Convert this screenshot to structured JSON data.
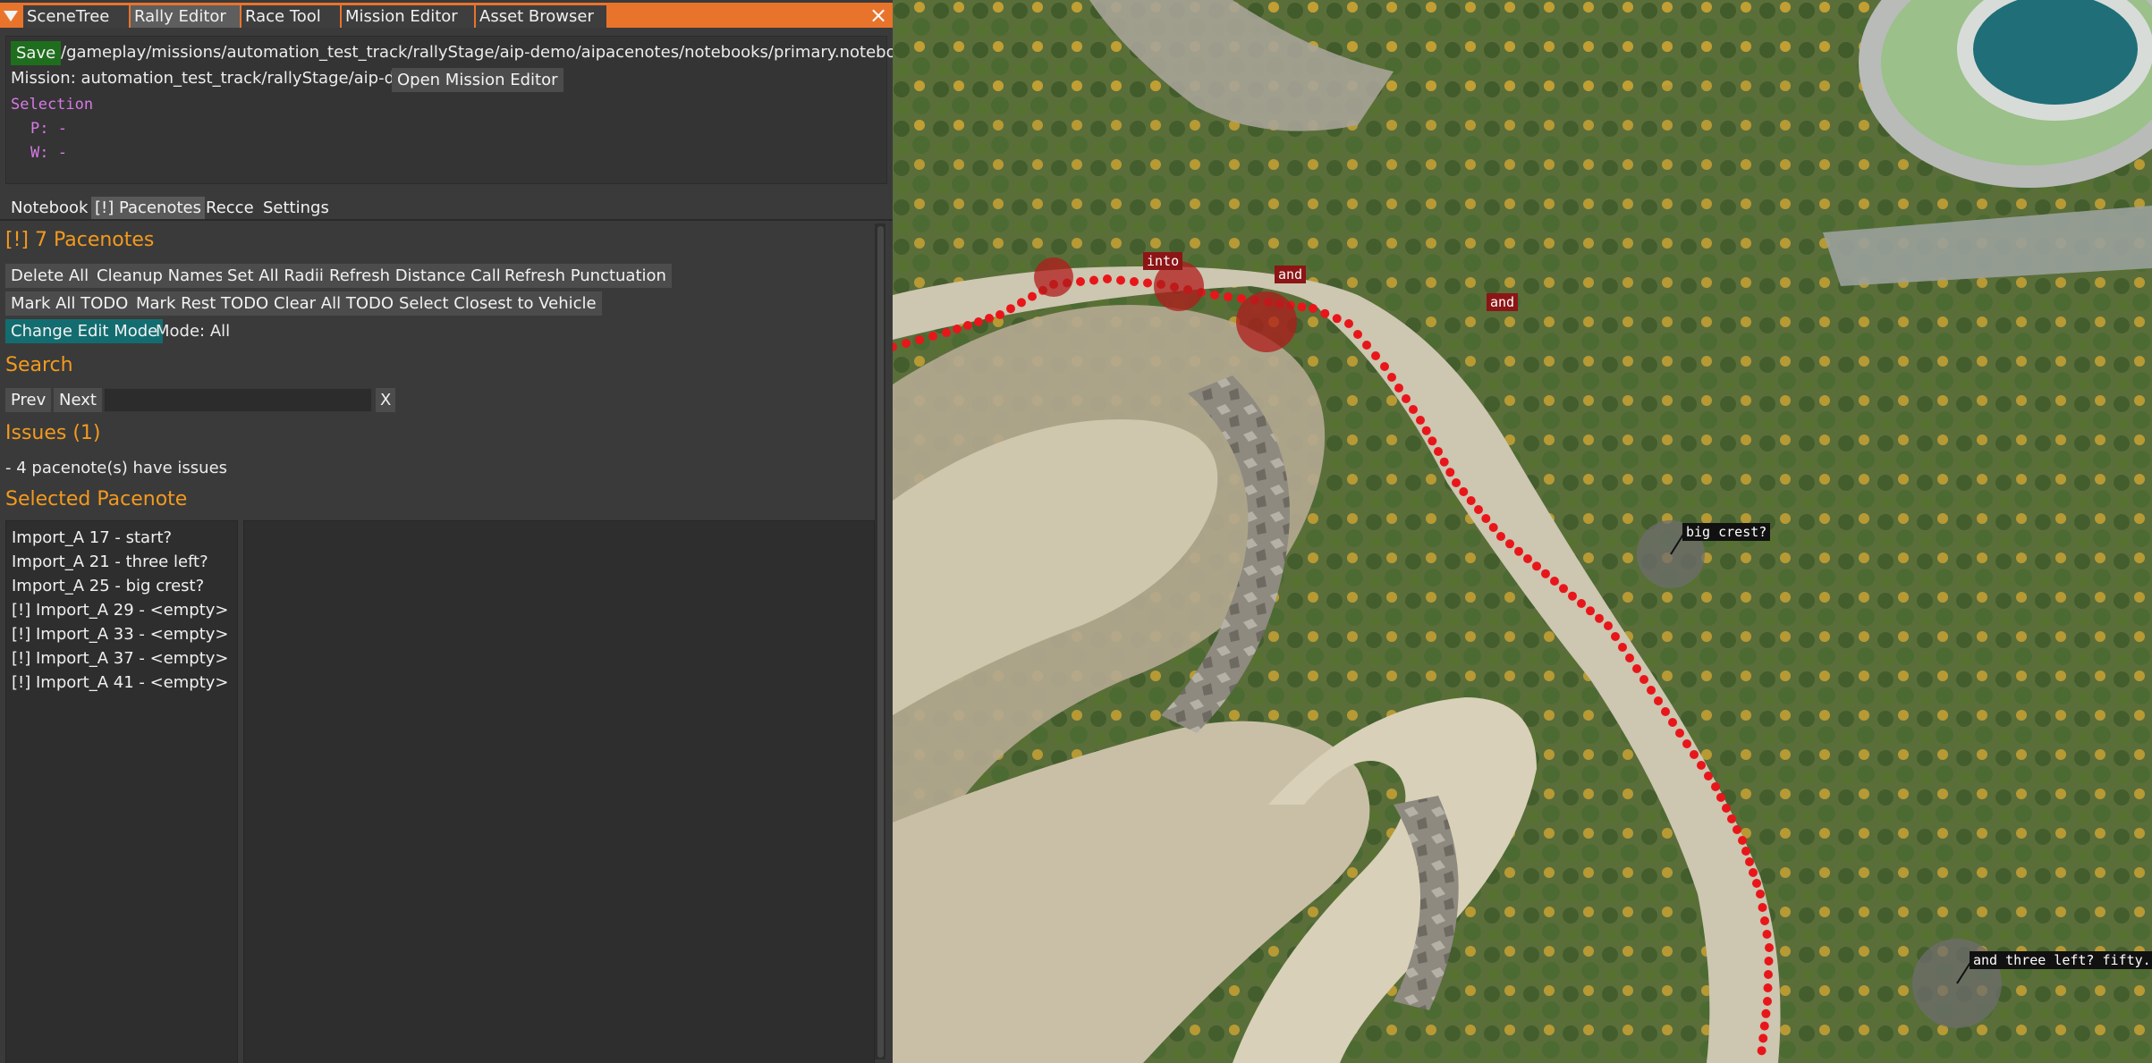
{
  "window_tabs": [
    "SceneTree",
    "Rally Editor",
    "Race Tool",
    "Mission Editor",
    "Asset Browser"
  ],
  "active_window_tab": "Rally Editor",
  "close_icon": "close-icon",
  "header": {
    "save_label": "Save",
    "notebook_path": "/gameplay/missions/automation_test_track/rallyStage/aip-demo/aipacenotes/notebooks/primary.notebook.json",
    "mission_text": "Mission: automation_test_track/rallyStage/aip-demo",
    "open_mission_editor_label": "Open Mission Editor",
    "selection_title": "Selection",
    "selection_p": "P: -",
    "selection_w": "W: -"
  },
  "sub_tabs": [
    "Notebook",
    "[!] Pacenotes",
    "Recce",
    "Settings"
  ],
  "active_sub_tab": "[!] Pacenotes",
  "pacenotes": {
    "title": "[!] 7 Pacenotes",
    "row1": [
      "Delete All",
      "Cleanup Names",
      "Set All Radii",
      "Refresh Distance Calls",
      "Refresh Punctuation"
    ],
    "row2": [
      "Mark All TODO",
      "Mark Rest TODO",
      "Clear All TODO",
      "Select Closest to Vehicle"
    ],
    "change_edit_mode_label": "Change Edit Mode",
    "mode_text": "Mode: All"
  },
  "search": {
    "title": "Search",
    "prev_label": "Prev",
    "next_label": "Next",
    "query": "",
    "clear_label": "X"
  },
  "issues": {
    "title": "Issues (1)",
    "line": "- 4 pacenote(s) have issues"
  },
  "selected_pacenote": {
    "title": "Selected Pacenote",
    "list": [
      "Import_A 17 - start?",
      "Import_A 21 - three left?",
      "Import_A 25 - big crest?",
      "[!] Import_A 29 - <empty>",
      "[!] Import_A 33 - <empty>",
      "[!] Import_A 37 - <empty>",
      "[!] Import_A 41 - <empty>"
    ]
  },
  "viewport": {
    "labels": [
      "into",
      "and",
      "and",
      "big crest?",
      "and three left? fifty."
    ],
    "colors": {
      "route_dots": "#e8161a",
      "red_marker": "#b01c1c",
      "gray_marker": "#6d6d6d",
      "accent_orange": "#e8742c",
      "section_orange": "#f39a1e"
    }
  }
}
